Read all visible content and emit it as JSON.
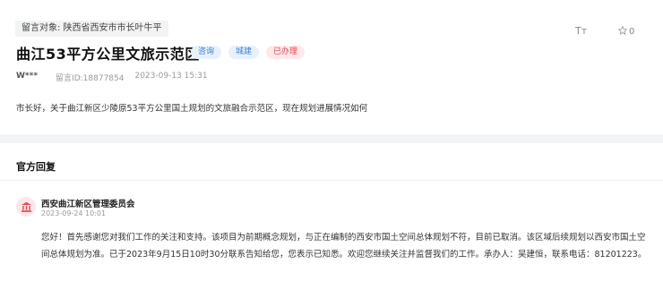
{
  "message": {
    "target_label": "留言对象: 陕西省西安市市长叶牛平",
    "title": "曲江53平方公里文旅示范区",
    "tags": [
      "咨询",
      "城建",
      "已办理"
    ],
    "author": "W***",
    "message_id": "留言ID:18877854",
    "datetime": "2023-09-13 15:31",
    "font_toggle_label": "Tт",
    "favorite_count": "0",
    "content": "市长好，关于曲江新区少陵原53平方公里国土规划的文旅融合示范区，现在规划进展情况如何"
  },
  "reply": {
    "heading": "官方回复",
    "org_name": "西安曲江新区管理委员会",
    "date": "2023-09-24 10:01",
    "text": "您好！首先感谢您对我们工作的关注和支持。该项目为前期概念规划，与正在编制的西安市国土空间总体规划不符，目前已取消。该区域后续规划以西安市国土空间总体规划为准。已于2023年9月15日10时30分联系告知给您，您表示已知悉。欢迎您继续关注并监督我们的工作。承办人：吴建恒，联系电话：81201223。"
  },
  "colors": {
    "accent_blue": "#3d7fd1",
    "accent_red": "#e04a52"
  }
}
